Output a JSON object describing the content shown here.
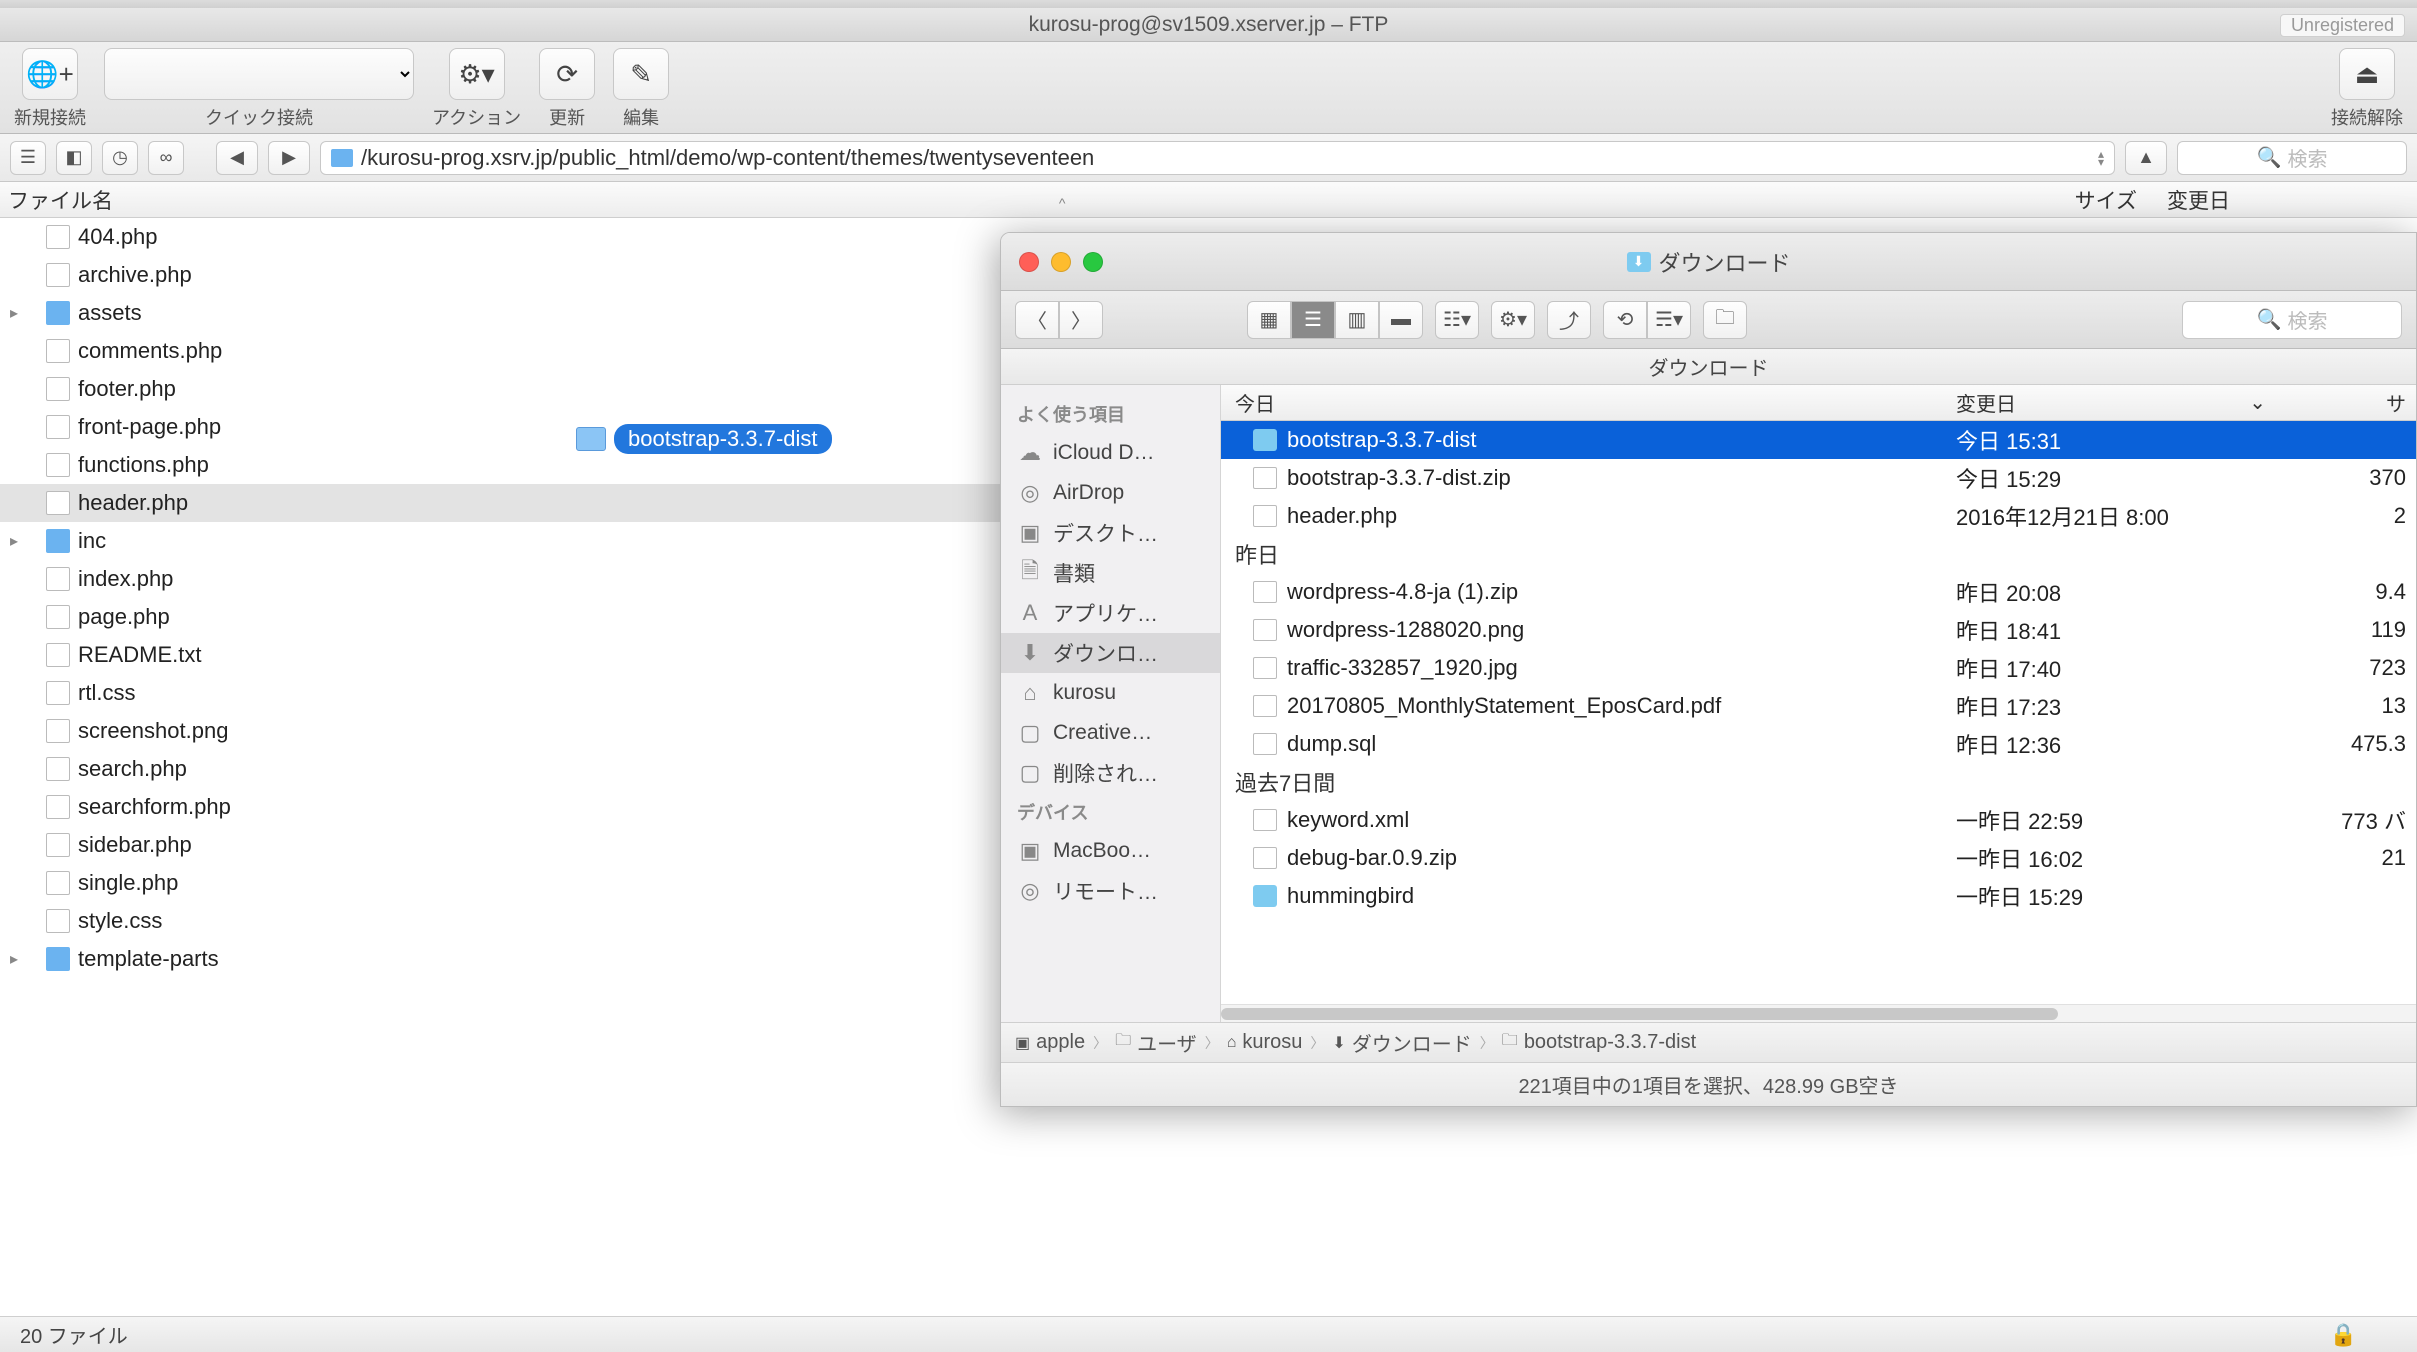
{
  "ftp": {
    "title": "kurosu-prog@sv1509.xserver.jp – FTP",
    "unregistered": "Unregistered",
    "toolbar": {
      "new_connection": "新規接続",
      "quick_connect": "クイック接続",
      "action": "アクション",
      "refresh": "更新",
      "edit": "編集",
      "disconnect": "接続解除"
    },
    "path": "/kurosu-prog.xsrv.jp/public_html/demo/wp-content/themes/twentyseventeen",
    "search_placeholder": "検索",
    "columns": {
      "name": "ファイル名",
      "size": "サイズ",
      "date": "変更日"
    },
    "files": [
      {
        "name": "404.php",
        "type": "file"
      },
      {
        "name": "archive.php",
        "type": "file"
      },
      {
        "name": "assets",
        "type": "folder"
      },
      {
        "name": "comments.php",
        "type": "file"
      },
      {
        "name": "footer.php",
        "type": "file"
      },
      {
        "name": "front-page.php",
        "type": "file"
      },
      {
        "name": "functions.php",
        "type": "file"
      },
      {
        "name": "header.php",
        "type": "file",
        "selected": true
      },
      {
        "name": "inc",
        "type": "folder"
      },
      {
        "name": "index.php",
        "type": "file"
      },
      {
        "name": "page.php",
        "type": "file"
      },
      {
        "name": "README.txt",
        "type": "file"
      },
      {
        "name": "rtl.css",
        "type": "file"
      },
      {
        "name": "screenshot.png",
        "type": "file"
      },
      {
        "name": "search.php",
        "type": "file"
      },
      {
        "name": "searchform.php",
        "type": "file"
      },
      {
        "name": "sidebar.php",
        "type": "file"
      },
      {
        "name": "single.php",
        "type": "file"
      },
      {
        "name": "style.css",
        "type": "file"
      },
      {
        "name": "template-parts",
        "type": "folder"
      }
    ],
    "drag_item": "bootstrap-3.3.7-dist",
    "status": "20 ファイル"
  },
  "finder": {
    "title": "ダウンロード",
    "search_placeholder": "検索",
    "crumb_title": "ダウンロード",
    "sidebar": {
      "favorites_header": "よく使う項目",
      "favorites": [
        {
          "label": "iCloud D…",
          "icon": "☁"
        },
        {
          "label": "AirDrop",
          "icon": "◎"
        },
        {
          "label": "デスクト…",
          "icon": "▣"
        },
        {
          "label": "書類",
          "icon": "🗎"
        },
        {
          "label": "アプリケ…",
          "icon": "A"
        },
        {
          "label": "ダウンロ…",
          "icon": "⬇",
          "selected": true
        },
        {
          "label": "kurosu",
          "icon": "⌂"
        },
        {
          "label": "Creative…",
          "icon": "▢"
        },
        {
          "label": "削除され…",
          "icon": "▢"
        }
      ],
      "devices_header": "デバイス",
      "devices": [
        {
          "label": "MacBoo…",
          "icon": "▣"
        },
        {
          "label": "リモート…",
          "icon": "◎"
        }
      ]
    },
    "columns": {
      "name": "今日",
      "date": "変更日",
      "size": "サ"
    },
    "groups": [
      {
        "header": "今日",
        "rows": [
          {
            "name": "bootstrap-3.3.7-dist",
            "date": "今日 15:31",
            "size": "",
            "icon": "fld",
            "selected": true
          },
          {
            "name": "bootstrap-3.3.7-dist.zip",
            "date": "今日 15:29",
            "size": "370",
            "icon": "zip"
          },
          {
            "name": "header.php",
            "date": "2016年12月21日 8:00",
            "size": "2",
            "icon": "zip"
          }
        ]
      },
      {
        "header": "昨日",
        "rows": [
          {
            "name": "wordpress-4.8-ja (1).zip",
            "date": "昨日 20:08",
            "size": "9.4",
            "icon": "zip"
          },
          {
            "name": "wordpress-1288020.png",
            "date": "昨日 18:41",
            "size": "119",
            "icon": "zip"
          },
          {
            "name": "traffic-332857_1920.jpg",
            "date": "昨日 17:40",
            "size": "723",
            "icon": "zip"
          },
          {
            "name": "20170805_MonthlyStatement_EposCard.pdf",
            "date": "昨日 17:23",
            "size": "13",
            "icon": "zip"
          },
          {
            "name": "dump.sql",
            "date": "昨日 12:36",
            "size": "475.3",
            "icon": "zip"
          }
        ]
      },
      {
        "header": "過去7日間",
        "rows": [
          {
            "name": "keyword.xml",
            "date": "一昨日 22:59",
            "size": "773 バ",
            "icon": "zip"
          },
          {
            "name": "debug-bar.0.9.zip",
            "date": "一昨日 16:02",
            "size": "21",
            "icon": "zip"
          },
          {
            "name": "hummingbird",
            "date": "一昨日 15:29",
            "size": "",
            "icon": "fld"
          }
        ]
      }
    ],
    "path": [
      "apple",
      "ユーザ",
      "kurosu",
      "ダウンロード",
      "bootstrap-3.3.7-dist"
    ],
    "status": "221項目中の1項目を選択、428.99 GB空き"
  }
}
